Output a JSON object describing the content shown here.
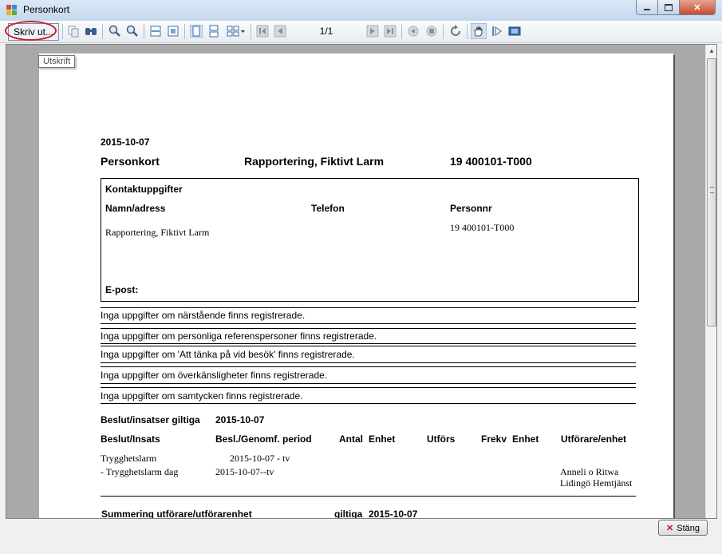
{
  "window": {
    "title": "Personkort"
  },
  "toolbar": {
    "print_label": "Skriv ut...",
    "page_counter": "1/1",
    "tooltip": "Utskrift"
  },
  "report": {
    "date": "2015-10-07",
    "heading": "Personkort",
    "subject": "Rapportering, Fiktivt Larm",
    "id": "19 400101-T000",
    "contact": {
      "title": "Kontaktuppgifter",
      "name_header": "Namn/adress",
      "phone_header": "Telefon",
      "personnr_header": "Personnr",
      "name_value": "Rapportering, Fiktivt Larm",
      "personnr_value": "19 400101-T000",
      "email_label": "E-post:"
    },
    "notes": [
      "Inga uppgifter om närstående finns registrerade.",
      "Inga uppgifter om personliga referenspersoner finns registrerade.",
      "Inga uppgifter om 'Att tänka på vid besök' finns registrerade.",
      "Inga uppgifter om överkänsligheter finns registrerade.",
      "Inga uppgifter om samtycken finns registrerade."
    ],
    "decisions": {
      "title": "Beslut/insatser giltiga",
      "date": "2015-10-07",
      "headers": [
        "Beslut/Insats",
        "Besl./Genomf. period",
        "Antal",
        "Enhet",
        "Utförs",
        "Frekv",
        "Enhet",
        "Utförare/enhet"
      ],
      "row1_insats": "Trygghetslarm",
      "row1_period": "2015-10-07 - tv",
      "row2_insats": "-  Trygghetslarm dag",
      "row2_period": "2015-10-07--tv",
      "row2_utforare_line1": "Anneli o Ritwa",
      "row2_utforare_line2": "Lidingö Hemtjänst"
    },
    "summary": {
      "title": "Summering utförare/utförarenhet",
      "valid_label": "giltiga",
      "date": "2015-10-07"
    }
  },
  "footer": {
    "close_label": "Stäng"
  }
}
